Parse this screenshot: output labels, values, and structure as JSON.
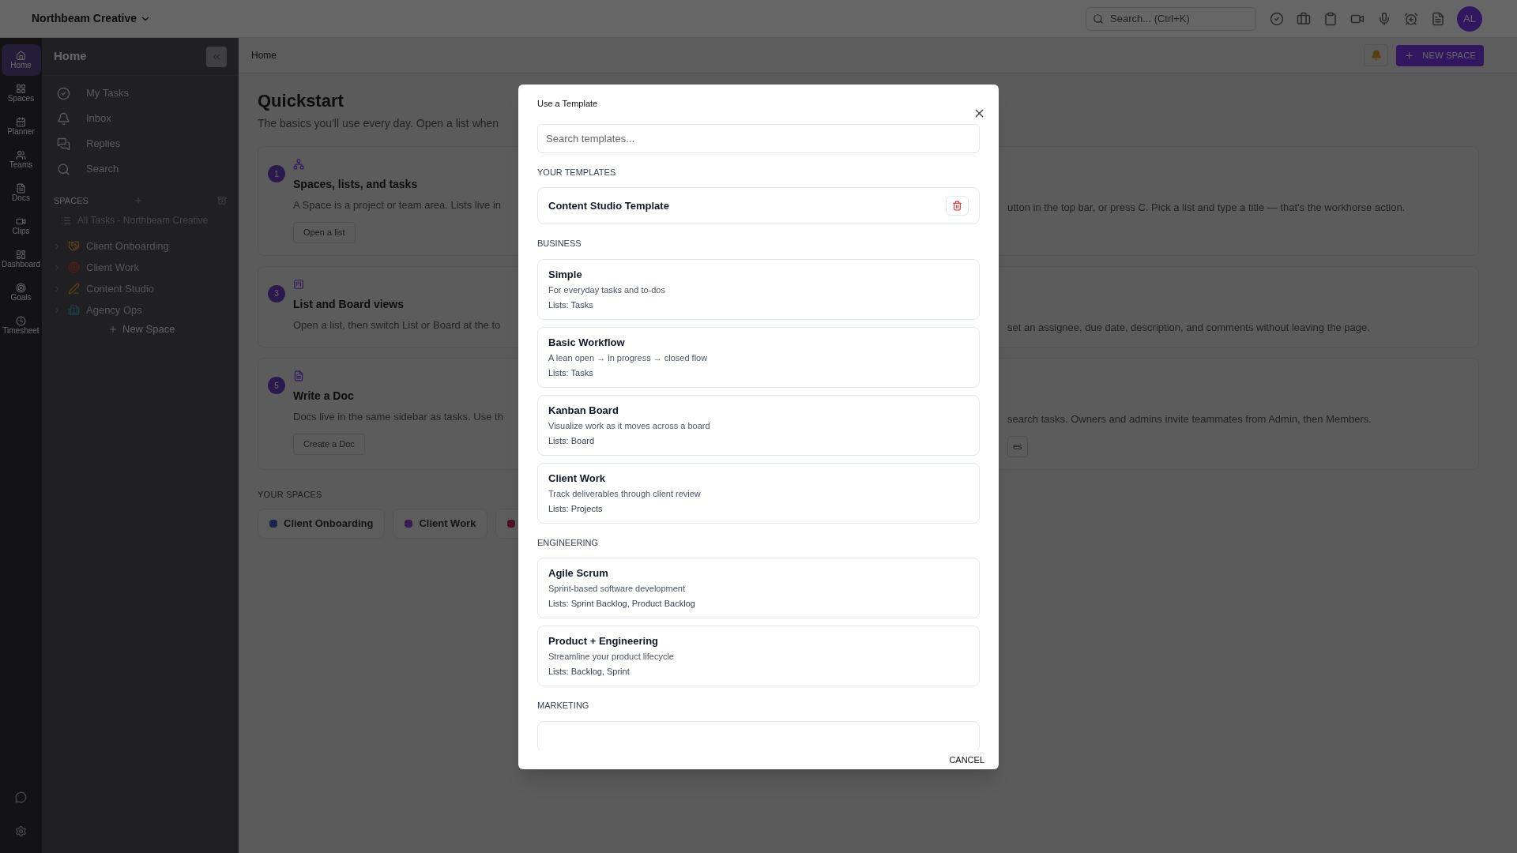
{
  "topbar": {
    "workspace": "Northbeam Creative",
    "search": {
      "placeholder": "Search... (Ctrl+K)"
    },
    "avatar": "AL"
  },
  "rail": {
    "items": [
      {
        "label": "Home",
        "selected": true
      },
      {
        "label": "Spaces",
        "selected": false
      },
      {
        "label": "Planner",
        "selected": false
      },
      {
        "label": "Teams",
        "selected": false
      },
      {
        "label": "Docs",
        "selected": false
      },
      {
        "label": "Clips",
        "selected": false
      },
      {
        "label": "Dashboard",
        "selected": false
      },
      {
        "label": "Goals",
        "selected": false
      },
      {
        "label": "Timesheet",
        "selected": false
      }
    ]
  },
  "sidebar": {
    "title": "Home",
    "nav": [
      "My Tasks",
      "Inbox",
      "Replies",
      "Search"
    ],
    "spaces_label": "SPACES",
    "all_tasks": "All Tasks - Northbeam Creative",
    "spaces": [
      "Client Onboarding",
      "Client Work",
      "Content Studio",
      "Agency Ops"
    ],
    "new_space": "New Space"
  },
  "breadcrumb": "Home",
  "new_space_button": "NEW SPACE",
  "quickstart": {
    "title": "Quickstart",
    "subtitle": "The basics you'll use every day. Open a list when",
    "rows": [
      {
        "number": "1",
        "title": "Spaces, lists, and tasks",
        "description": "A Space is a project or team area. Lists live in",
        "button": "Open a list",
        "right_description": "utton in the top bar, or press C. Pick a list and type a title — that's the workhorse action."
      },
      {
        "number": "3",
        "title": "List and Board views",
        "description": "Open a list, then switch List or Board at the to",
        "right_description": "set an assignee, due date, description, and comments without leaving the page."
      },
      {
        "number": "5",
        "title": "Write a Doc",
        "description": "Docs live in the same sidebar as tasks. Use th",
        "button": "Create a Doc",
        "right_description": "search tasks. Owners and admins invite teammates from Admin, then Members.",
        "right_button": "es"
      }
    ]
  },
  "your_spaces": {
    "label": "YOUR SPACES",
    "chips": [
      {
        "label": "Client Onboarding",
        "color": "#182650"
      },
      {
        "label": "Client Work",
        "color": "#391b50"
      },
      {
        "color": "#4d1324"
      }
    ]
  },
  "modal": {
    "title": "Use a Template",
    "search": {
      "placeholder": "Search templates..."
    },
    "sections": [
      {
        "label": "YOUR TEMPLATES",
        "templates": [
          {
            "kind": "custom",
            "name": "Content Studio Template"
          }
        ]
      },
      {
        "label": "BUSINESS",
        "templates": [
          {
            "kind": "builtin",
            "name": "Simple",
            "description": "For everyday tasks and to-dos",
            "lists": "Lists: Tasks"
          },
          {
            "kind": "builtin",
            "name": "Basic Workflow",
            "description": "A lean open → in progress → closed flow",
            "lists": "Lists: Tasks"
          },
          {
            "kind": "builtin",
            "name": "Kanban Board",
            "description": "Visualize work as it moves across a board",
            "lists": "Lists: Board"
          },
          {
            "kind": "builtin",
            "name": "Client Work",
            "description": "Track deliverables through client review",
            "lists": "Lists: Projects"
          }
        ]
      },
      {
        "label": "ENGINEERING",
        "templates": [
          {
            "kind": "builtin",
            "name": "Agile Scrum",
            "description": "Sprint-based software development",
            "lists": "Lists: Sprint Backlog, Product Backlog"
          },
          {
            "kind": "builtin",
            "name": "Product + Engineering",
            "description": "Streamline your product lifecycle",
            "lists": "Lists: Backlog, Sprint"
          }
        ]
      },
      {
        "label": "MARKETING",
        "templates": [
          {
            "kind": "clipped"
          }
        ]
      }
    ],
    "cancel": "CANCEL"
  }
}
